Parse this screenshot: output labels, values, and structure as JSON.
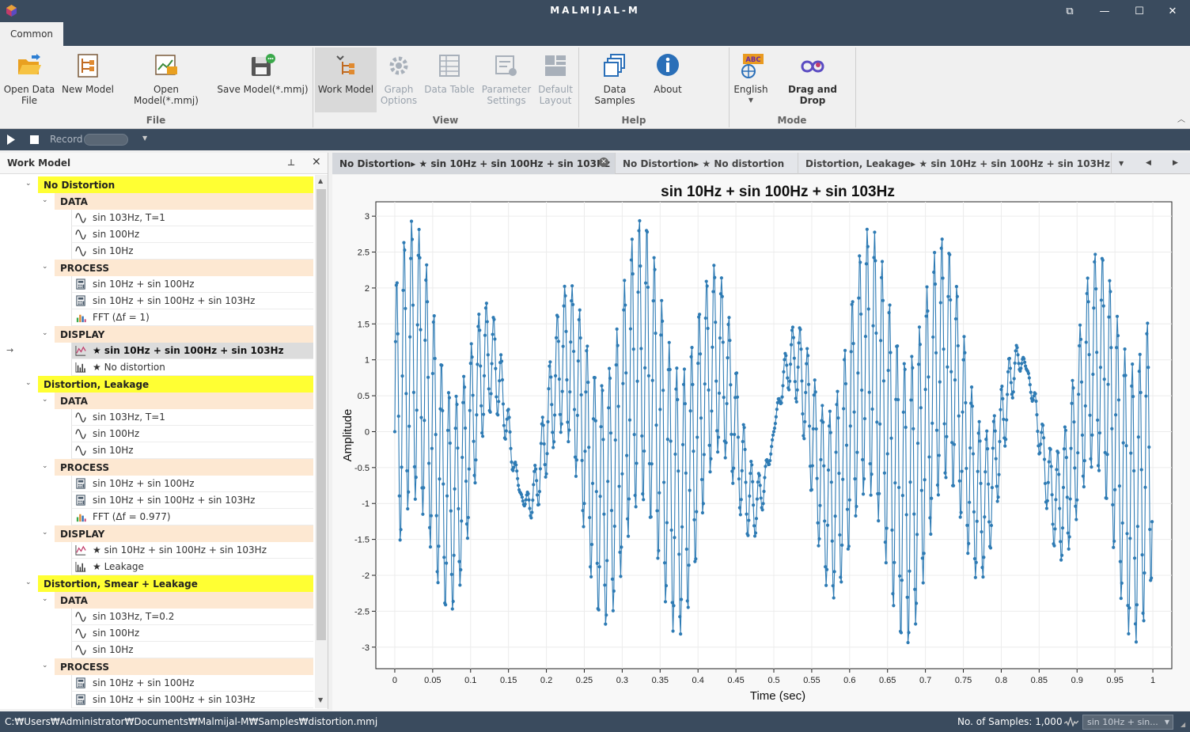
{
  "window": {
    "title": "MALMIJAL-M",
    "buttons": [
      "⧉",
      "—",
      "☐",
      "✕"
    ]
  },
  "ribbon": {
    "tab": "Common",
    "groups": [
      {
        "label": "File",
        "buttons": [
          {
            "label1": "Open Data",
            "label2": "File"
          },
          {
            "label1": "New Model",
            "label2": ""
          },
          {
            "label1": "Open Model(*.mmj)",
            "label2": ""
          },
          {
            "label1": "Save Model(*.mmj)",
            "label2": ""
          }
        ]
      },
      {
        "label": "View",
        "buttons": [
          {
            "label1": "Work Model",
            "label2": ""
          },
          {
            "label1": "Graph",
            "label2": "Options"
          },
          {
            "label1": "Data Table",
            "label2": ""
          },
          {
            "label1": "Parameter",
            "label2": "Settings"
          },
          {
            "label1": "Default",
            "label2": "Layout"
          }
        ]
      },
      {
        "label": "Help",
        "buttons": [
          {
            "label1": "Data Samples",
            "label2": ""
          },
          {
            "label1": "About",
            "label2": ""
          }
        ]
      },
      {
        "label": "Mode",
        "buttons": [
          {
            "label1": "English",
            "label2": "",
            "badge": "ABC"
          },
          {
            "label1": "Drag and Drop",
            "label2": ""
          }
        ]
      }
    ]
  },
  "record_bar": {
    "record_label": "Record"
  },
  "work_model": {
    "title": "Work Model",
    "tree": [
      {
        "kind": "model",
        "label": "No Distortion"
      },
      {
        "kind": "section",
        "label": "DATA"
      },
      {
        "kind": "leaf",
        "icon": "sine-wave-icon",
        "label": "sin 103Hz, T=1"
      },
      {
        "kind": "leaf",
        "icon": "sine-wave-icon",
        "label": "sin 100Hz"
      },
      {
        "kind": "leaf",
        "icon": "sine-wave-icon",
        "label": "sin 10Hz"
      },
      {
        "kind": "section",
        "label": "PROCESS"
      },
      {
        "kind": "leaf",
        "icon": "calculator-icon",
        "label": "sin 10Hz + sin 100Hz"
      },
      {
        "kind": "leaf",
        "icon": "calculator-icon",
        "label": "sin 10Hz + sin 100Hz + sin 103Hz"
      },
      {
        "kind": "leaf",
        "icon": "fft-chart-icon",
        "label": "FFT (Δf = 1)"
      },
      {
        "kind": "section",
        "label": "DISPLAY"
      },
      {
        "kind": "leaf",
        "icon": "line-chart-icon",
        "label": "★ sin 10Hz + sin 100Hz + sin 103Hz",
        "selected": true
      },
      {
        "kind": "leaf",
        "icon": "bar-chart-icon",
        "label": "★ No distortion"
      },
      {
        "kind": "model",
        "label": "Distortion, Leakage"
      },
      {
        "kind": "section",
        "label": "DATA"
      },
      {
        "kind": "leaf",
        "icon": "sine-wave-icon",
        "label": "sin 103Hz, T=1"
      },
      {
        "kind": "leaf",
        "icon": "sine-wave-icon",
        "label": "sin 100Hz"
      },
      {
        "kind": "leaf",
        "icon": "sine-wave-icon",
        "label": "sin 10Hz"
      },
      {
        "kind": "section",
        "label": "PROCESS"
      },
      {
        "kind": "leaf",
        "icon": "calculator-icon",
        "label": "sin 10Hz + sin 100Hz"
      },
      {
        "kind": "leaf",
        "icon": "calculator-icon",
        "label": "sin 10Hz + sin 100Hz + sin 103Hz"
      },
      {
        "kind": "leaf",
        "icon": "fft-chart-icon",
        "label": "FFT (Δf = 0.977)"
      },
      {
        "kind": "section",
        "label": "DISPLAY"
      },
      {
        "kind": "leaf",
        "icon": "line-chart-icon",
        "label": "★ sin 10Hz + sin 100Hz + sin 103Hz"
      },
      {
        "kind": "leaf",
        "icon": "bar-chart-icon",
        "label": "★ Leakage"
      },
      {
        "kind": "model",
        "label": "Distortion, Smear + Leakage"
      },
      {
        "kind": "section",
        "label": "DATA"
      },
      {
        "kind": "leaf",
        "icon": "sine-wave-icon",
        "label": "sin 103Hz, T=0.2"
      },
      {
        "kind": "leaf",
        "icon": "sine-wave-icon",
        "label": "sin 100Hz"
      },
      {
        "kind": "leaf",
        "icon": "sine-wave-icon",
        "label": "sin 10Hz"
      },
      {
        "kind": "section",
        "label": "PROCESS"
      },
      {
        "kind": "leaf",
        "icon": "calculator-icon",
        "label": "sin 10Hz + sin 100Hz"
      },
      {
        "kind": "leaf",
        "icon": "calculator-icon",
        "label": "sin 10Hz + sin 100Hz + sin 103Hz"
      }
    ]
  },
  "doc_tabs": [
    {
      "label": "No Distortion▸ ★ sin 10Hz + sin 100Hz + sin 103Hz",
      "active": true
    },
    {
      "label": "No Distortion▸ ★ No distortion",
      "active": false
    },
    {
      "label": "Distortion, Leakage▸ ★ sin 10Hz + sin 100Hz + sin 103Hz",
      "active": false
    }
  ],
  "chart_data": {
    "type": "line",
    "title": "sin 10Hz + sin 100Hz + sin 103Hz",
    "xlabel": "Time (sec)",
    "ylabel": "Amplitude",
    "xlim": [
      -0.025,
      1.025
    ],
    "ylim": [
      -3.3,
      3.2
    ],
    "xticks": [
      "0",
      "0.05",
      "0.1",
      "0.15",
      "0.2",
      "0.25",
      "0.3",
      "0.35",
      "0.4",
      "0.45",
      "0.5",
      "0.55",
      "0.6",
      "0.65",
      "0.7",
      "0.75",
      "0.8",
      "0.85",
      "0.9",
      "0.95",
      "1"
    ],
    "yticks": [
      "3",
      "2.5",
      "2",
      "1.5",
      "1",
      "0.5",
      "0",
      "-0.5",
      "-1",
      "-1.5",
      "-2",
      "-2.5",
      "-3"
    ],
    "grid": true,
    "marker": "dot",
    "color": "#2e7bb4",
    "series": [
      {
        "signal": "sin(2π·10t) + sin(2π·100t) + sin(2π·103t)",
        "t_start": 0,
        "t_end": 1,
        "samples": 1000
      }
    ]
  },
  "status": {
    "path": "C:₩Users₩Administrator₩Documents₩Malmijal-M₩Samples₩distortion.mmj",
    "samples": "No. of Samples: 1,000",
    "combo": "sin 10Hz + sin..."
  },
  "colors": {
    "chrome": "#3a4b5e",
    "model_header": "#ffff33",
    "section_header": "#fde8d2",
    "series": "#2e7bb4"
  }
}
